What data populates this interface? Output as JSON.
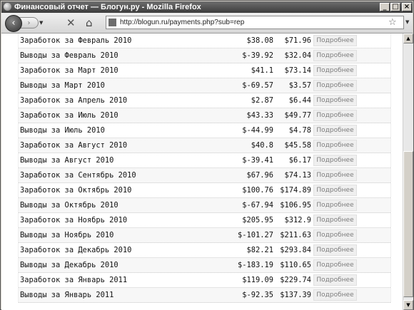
{
  "window": {
    "title": "Финансовый отчет — Блогун.ру - Mozilla Firefox",
    "url": "http://blogun.ru/payments.php?sub=rep"
  },
  "report": {
    "details_label": "Подробнее",
    "rows": [
      {
        "label": "Заработок за Февраль 2010",
        "amount": "$38.08",
        "total": "$71.96"
      },
      {
        "label": "Выводы за Февраль 2010",
        "amount": "$-39.92",
        "total": "$32.04"
      },
      {
        "label": "Заработок за Март 2010",
        "amount": "$41.1",
        "total": "$73.14"
      },
      {
        "label": "Выводы за Март 2010",
        "amount": "$-69.57",
        "total": "$3.57"
      },
      {
        "label": "Заработок за Апрель 2010",
        "amount": "$2.87",
        "total": "$6.44"
      },
      {
        "label": "Заработок за Июль 2010",
        "amount": "$43.33",
        "total": "$49.77"
      },
      {
        "label": "Выводы за Июль 2010",
        "amount": "$-44.99",
        "total": "$4.78"
      },
      {
        "label": "Заработок за Август 2010",
        "amount": "$40.8",
        "total": "$45.58"
      },
      {
        "label": "Выводы за Август 2010",
        "amount": "$-39.41",
        "total": "$6.17"
      },
      {
        "label": "Заработок за Сентябрь 2010",
        "amount": "$67.96",
        "total": "$74.13"
      },
      {
        "label": "Заработок за Октябрь 2010",
        "amount": "$100.76",
        "total": "$174.89"
      },
      {
        "label": "Выводы за Октябрь 2010",
        "amount": "$-67.94",
        "total": "$106.95"
      },
      {
        "label": "Заработок за Ноябрь 2010",
        "amount": "$205.95",
        "total": "$312.9"
      },
      {
        "label": "Выводы за Ноябрь 2010",
        "amount": "$-101.27",
        "total": "$211.63"
      },
      {
        "label": "Заработок за Декабрь 2010",
        "amount": "$82.21",
        "total": "$293.84"
      },
      {
        "label": "Выводы за Декабрь 2010",
        "amount": "$-183.19",
        "total": "$110.65"
      },
      {
        "label": "Заработок за Январь 2011",
        "amount": "$119.09",
        "total": "$229.74"
      },
      {
        "label": "Выводы за Январь 2011",
        "amount": "$-92.35",
        "total": "$137.39"
      }
    ]
  }
}
